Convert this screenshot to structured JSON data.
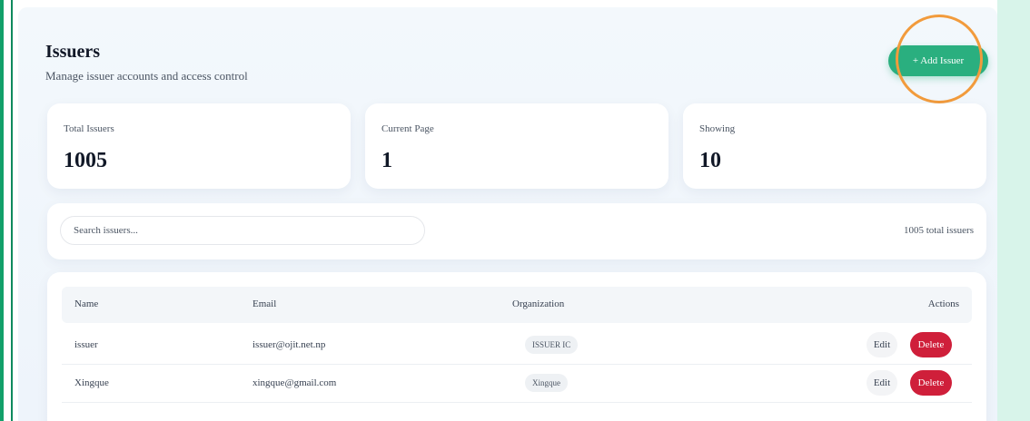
{
  "header": {
    "title": "Issuers",
    "subtitle": "Manage issuer accounts and access control",
    "add_button_label": "+ Add Issuer"
  },
  "stats": [
    {
      "label": "Total Issuers",
      "value": "1005"
    },
    {
      "label": "Current Page",
      "value": "1"
    },
    {
      "label": "Showing",
      "value": "10"
    }
  ],
  "search": {
    "placeholder": "Search issuers...",
    "value": "",
    "total_text": "1005 total issuers"
  },
  "table": {
    "columns": [
      "Name",
      "Email",
      "Organization",
      "Actions"
    ],
    "rows": [
      {
        "name": "issuer",
        "email": "issuer@ojit.net.np",
        "organization": "ISSUER IC",
        "edit_label": "Edit",
        "delete_label": "Delete"
      },
      {
        "name": "Xingque",
        "email": "xingque@gmail.com",
        "organization": "Xingque",
        "edit_label": "Edit",
        "delete_label": "Delete"
      }
    ]
  },
  "colors": {
    "accent": "#2aaf7f",
    "danger": "#cf1f3a",
    "highlight": "#f29b3c",
    "side_panel": "#d8f4ea"
  }
}
